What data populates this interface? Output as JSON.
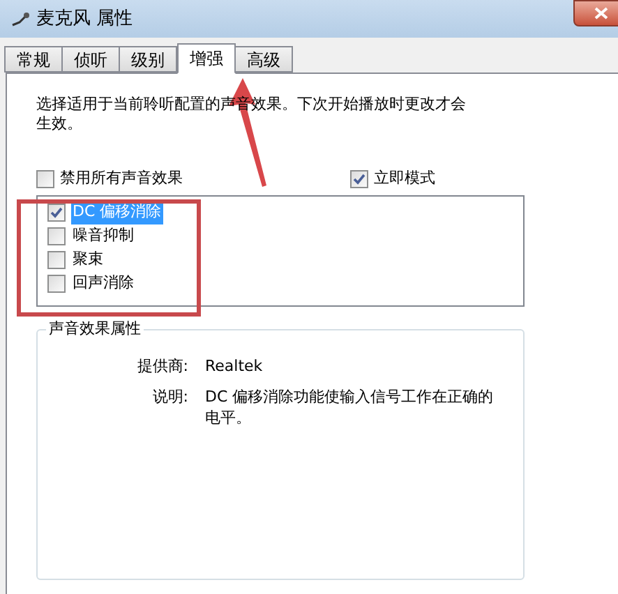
{
  "window": {
    "title": "麦克风 属性"
  },
  "tabs": [
    {
      "label": "常规",
      "selected": false
    },
    {
      "label": "侦听",
      "selected": false
    },
    {
      "label": "级别",
      "selected": false
    },
    {
      "label": "增强",
      "selected": true
    },
    {
      "label": "高级",
      "selected": false
    }
  ],
  "intro": "选择适用于当前聆听配置的声音效果。下次开始播放时更改才会生效。",
  "options": [
    {
      "label": "禁用所有声音效果",
      "checked": false
    },
    {
      "label": "立即模式",
      "checked": true
    }
  ],
  "effects": [
    {
      "label": "DC 偏移消除",
      "checked": true,
      "selected": true
    },
    {
      "label": "噪音抑制",
      "checked": false,
      "selected": false
    },
    {
      "label": "聚束",
      "checked": false,
      "selected": false
    },
    {
      "label": "回声消除",
      "checked": false,
      "selected": false
    }
  ],
  "properties": {
    "title": "声音效果属性",
    "rows": [
      {
        "label": "提供商:",
        "value": "Realtek"
      },
      {
        "label": "说明:",
        "value": "DC 偏移消除功能使输入信号工作在正确的电平。"
      }
    ]
  }
}
